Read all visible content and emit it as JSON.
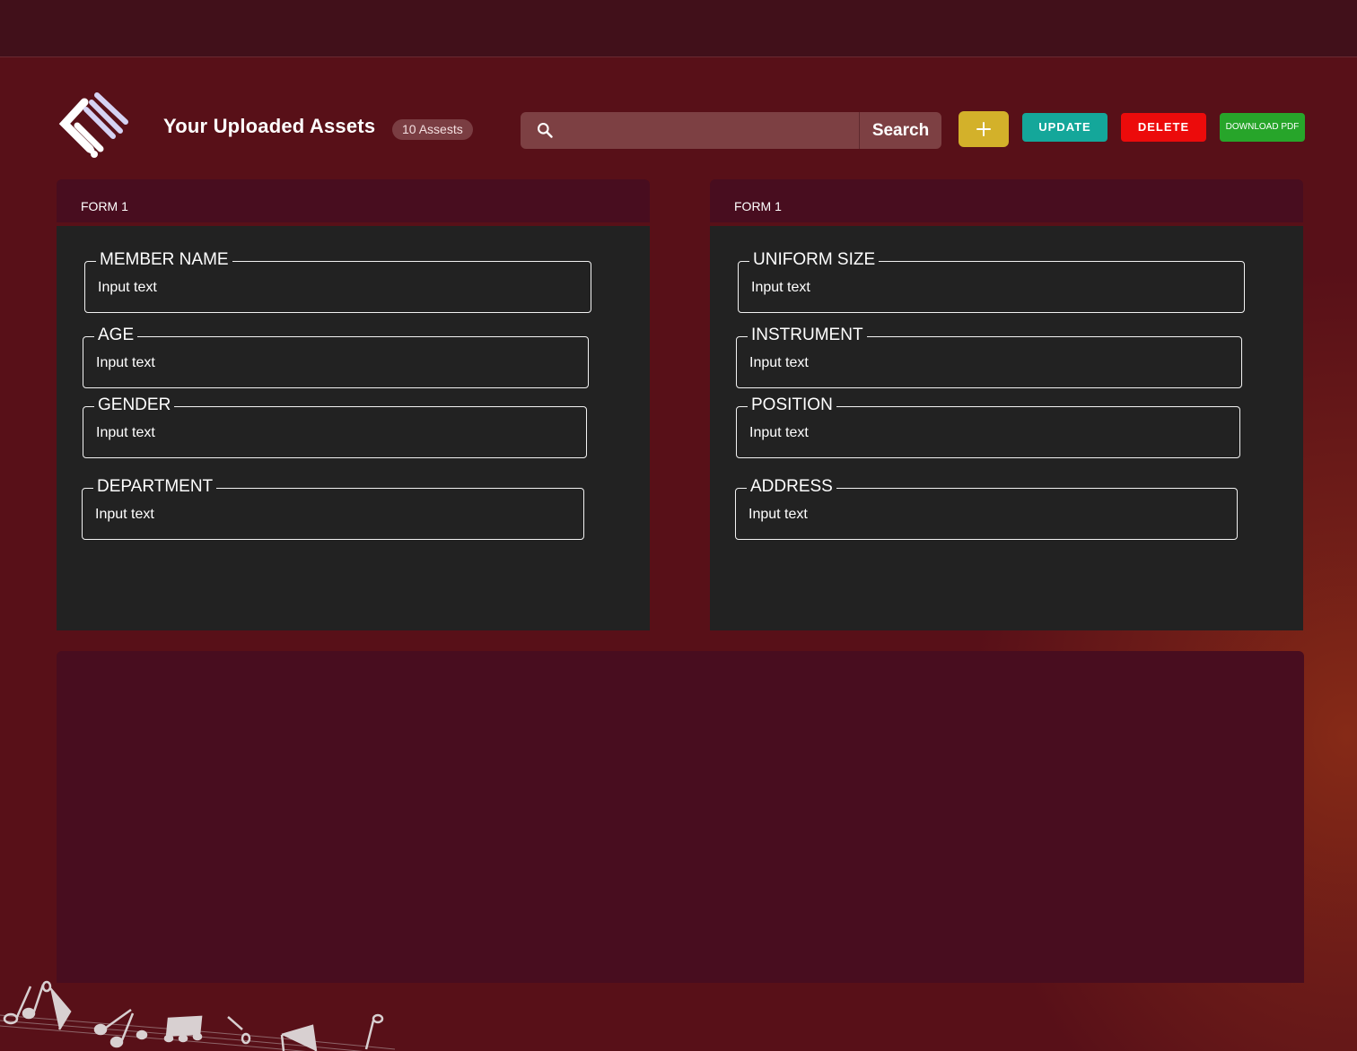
{
  "header": {
    "title": "Your Uploaded Assets",
    "asset_count": "10 Assests"
  },
  "search": {
    "placeholder": "",
    "button_label": "Search"
  },
  "toolbar": {
    "add_label": "+",
    "update_label": "UPDATE",
    "delete_label": "DELETE",
    "download_label": "DOWNLOAD PDF"
  },
  "forms": [
    {
      "title": "FORM 1",
      "fields": [
        {
          "label": "MEMBER NAME",
          "placeholder": "Input text"
        },
        {
          "label": "AGE",
          "placeholder": "Input text"
        },
        {
          "label": "GENDER",
          "placeholder": "Input text"
        },
        {
          "label": "DEPARTMENT",
          "placeholder": "Input text"
        }
      ]
    },
    {
      "title": "FORM 1",
      "fields": [
        {
          "label": "UNIFORM SIZE",
          "placeholder": "Input text"
        },
        {
          "label": "INSTRUMENT",
          "placeholder": "Input text"
        },
        {
          "label": "POSITION",
          "placeholder": "Input text"
        },
        {
          "label": "ADDRESS",
          "placeholder": "Input text"
        }
      ]
    }
  ],
  "colors": {
    "background": "#581018",
    "topbar": "#41101a",
    "panel": "#480d1f",
    "form_body": "#222222",
    "add_button": "#d3b12a",
    "update_button": "#14a79a",
    "delete_button": "#ec0b0b",
    "download_button": "#27a52a"
  },
  "icons": {
    "logo": "brand-logo-icon",
    "search": "search-icon",
    "add": "plus-icon",
    "decoration": "music-notes-icon"
  }
}
